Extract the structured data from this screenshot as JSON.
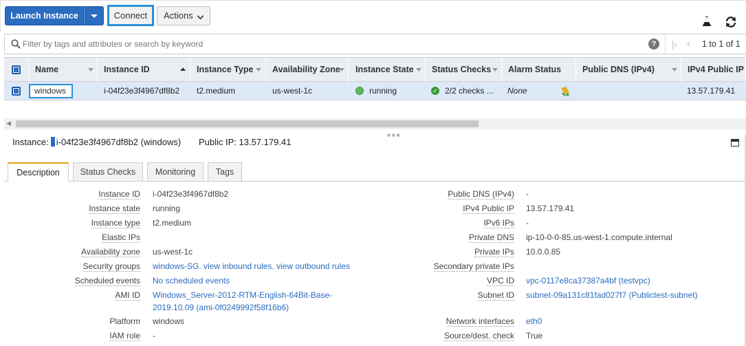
{
  "toolbar": {
    "launch_label": "Launch Instance",
    "connect_label": "Connect",
    "actions_label": "Actions",
    "icons": [
      "flask-icon",
      "refresh-icon"
    ]
  },
  "filter": {
    "placeholder": "Filter by tags and attributes or search by keyword",
    "value": "",
    "help": "?",
    "page_info": "1 to 1 of 1"
  },
  "grid": {
    "columns": [
      "Name",
      "Instance ID",
      "Instance Type",
      "Availability Zone",
      "Instance State",
      "Status Checks",
      "Alarm Status",
      "Public DNS (IPv4)",
      "IPv4 Public IP"
    ],
    "row": {
      "name": "windows",
      "instance_id": "i-04f23e3f4967df8b2",
      "instance_type": "t2.medium",
      "availability_zone": "us-west-1c",
      "instance_state": "running",
      "status_checks": "2/2 checks ...",
      "alarm_status": "None",
      "public_dns": "",
      "public_ip": "13.57.179.41"
    }
  },
  "details": {
    "instance_label": "Instance:",
    "instance_text": "i-04f23e3f4967df8b2 (windows)",
    "public_ip_text": "Public IP: 13.57.179.41",
    "tabs": [
      "Description",
      "Status Checks",
      "Monitoring",
      "Tags"
    ],
    "left": [
      {
        "label": "Instance ID",
        "value": "i-04f23e3f4967df8b2"
      },
      {
        "label": "Instance state",
        "value": "running"
      },
      {
        "label": "Instance type",
        "value": "t2.medium"
      },
      {
        "label": "Elastic IPs",
        "value": ""
      },
      {
        "label": "Availability zone",
        "value": "us-west-1c"
      },
      {
        "label": "Security groups",
        "value": "windows-SG. view inbound rules. view outbound rules"
      },
      {
        "label": "Scheduled events",
        "value": "No scheduled events"
      },
      {
        "label": "AMI ID",
        "value": "Windows_Server-2012-RTM-English-64Bit-Base-",
        "value2": "2019.10.09 (ami-0f0249992f58f16b6)"
      },
      {
        "label": "Platform",
        "value": "windows"
      },
      {
        "label": "IAM role",
        "value": "-"
      }
    ],
    "right": [
      {
        "label": "Public DNS (IPv4)",
        "value": "-"
      },
      {
        "label": "IPv4 Public IP",
        "value": "13.57.179.41"
      },
      {
        "label": "IPv6 IPs",
        "value": "-"
      },
      {
        "label": "Private DNS",
        "value": "ip-10-0-0-85.us-west-1.compute.internal"
      },
      {
        "label": "Private IPs",
        "value": "10.0.0.85"
      },
      {
        "label": "Secondary private IPs",
        "value": ""
      },
      {
        "label": "VPC ID",
        "value": "vpc-0117e8ca37387a4bf (testvpc)"
      },
      {
        "label": "Subnet ID",
        "value": "subnet-09a131c81fad027f7 (Publictest-subnet)"
      },
      {
        "label": "Network interfaces",
        "value": "eth0"
      },
      {
        "label": "Source/dest. check",
        "value": "True"
      }
    ]
  }
}
